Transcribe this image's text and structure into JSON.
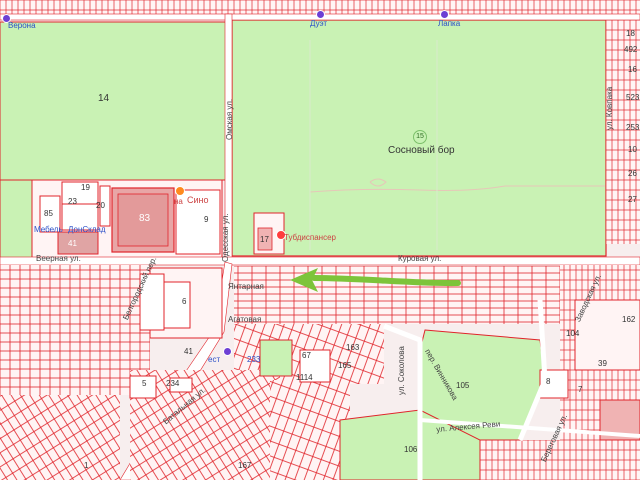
{
  "places": {
    "verona": "Верона",
    "duet": "Дуэт",
    "lapka": "Лапка",
    "sino": "Сино",
    "sino_prefix": "на",
    "tubdispanser": "Тубдиспансер",
    "mebel": "Мебель",
    "donsklad": "ДонСклад",
    "pitstop": "ест",
    "bus": "233"
  },
  "park": {
    "name": "Сосновый бор",
    "badge": "15"
  },
  "streets": {
    "omskaya": "Омская ул.",
    "veernaya": "Веерная ул.",
    "kurovaya": "Куровая ул.",
    "yantarnaya": "Янтарная",
    "agatovaya": "Агатовая",
    "odesskaya": "Одесская ул.",
    "belgorodskiy": "Белгородский пер.",
    "batalnaya": "Батальная ул.",
    "pochtovaya": "Почтовая",
    "vinnikova": "пер. Винникова",
    "sokolova": "ул. Соколова",
    "alekseeva": "ул. Алексея Реви",
    "zavodskaya": "Заводская ул.",
    "rodnikovaya": "ул.",
    "kovpaka": "ул. Ковпака",
    "bereg": "Береговая ул."
  },
  "block_numbers": {
    "n14": "14",
    "n19": "19",
    "n23": "23",
    "n85": "85",
    "n20": "20",
    "n83": "83",
    "n9": "9",
    "n45": "45",
    "n41": "41",
    "n17": "17",
    "n6": "6",
    "n41b": "41",
    "n5": "5",
    "n234": "234",
    "n1": "1",
    "n67": "67",
    "n1114": "1114",
    "n165": "165",
    "n105": "105",
    "n106": "106",
    "n8": "8",
    "n7": "7",
    "n39": "39",
    "n162": "162",
    "n104": "104",
    "n492": "492",
    "n523": "523",
    "n253": "253",
    "n26": "26",
    "n27": "27",
    "n16": "16",
    "n18": "18",
    "n10": "10",
    "n167": "167",
    "n163": "163"
  },
  "colors": {
    "background": "#f7eeee",
    "green": "#c9f2b4",
    "lot_red": "#e0242b",
    "road": "#ffffff",
    "arrow": "#7dc43a"
  },
  "icons": {
    "poi": "purple-poi-pin-icon",
    "orange": "orange-poi-pin-icon",
    "medical": "red-medical-pin-icon",
    "arrow": "green-arrow-icon"
  }
}
